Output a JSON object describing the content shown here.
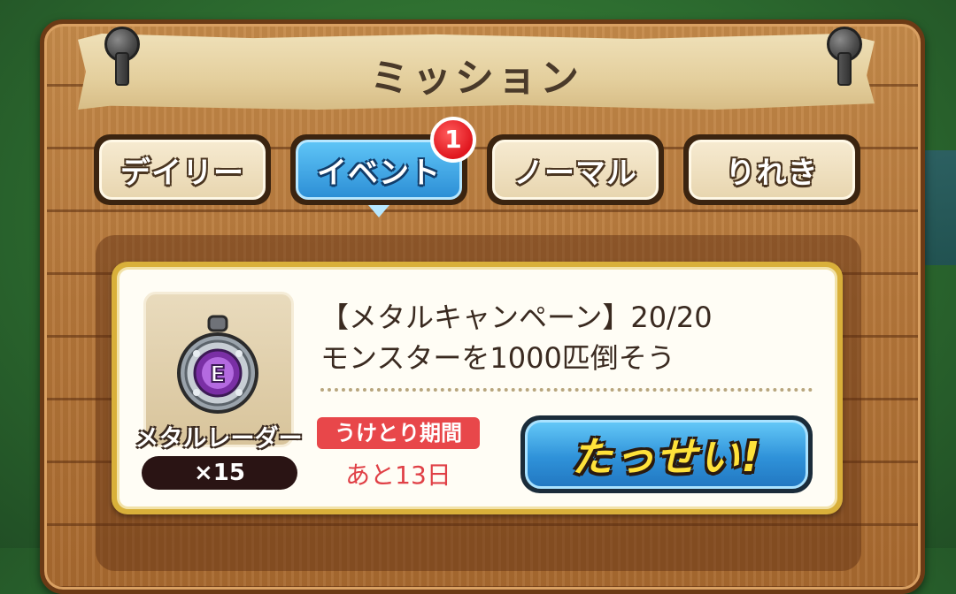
{
  "window": {
    "title": "ミッション"
  },
  "tabs": [
    {
      "label": "デイリー",
      "active": false
    },
    {
      "label": "イベント",
      "active": true,
      "badge": "1"
    },
    {
      "label": "ノーマル",
      "active": false
    },
    {
      "label": "りれき",
      "active": false
    }
  ],
  "mission": {
    "title": "【メタルキャンペーン】20/20",
    "description": "モンスターを1000匹倒そう",
    "reward": {
      "name": "メタルレーダー",
      "count": "×15",
      "icon": "metal-radar-icon",
      "icon_letter": "E"
    },
    "period_label": "うけとり期間",
    "period_value": "あと13日",
    "action_label": "たっせい!"
  },
  "colors": {
    "tab_active": "#2d8fd6",
    "tab_inactive": "#e8d6b0",
    "badge": "#e0161e",
    "period_label_bg": "#e8474a",
    "action_text": "#ffe23a"
  }
}
